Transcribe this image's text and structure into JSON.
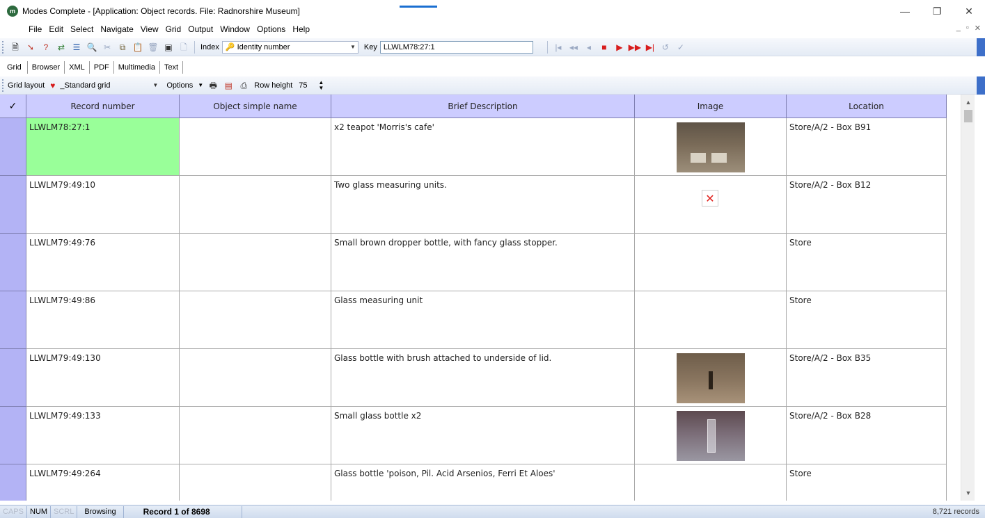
{
  "window": {
    "title": "Modes Complete - [Application: Object records. File: Radnorshire Museum]",
    "logo": "m",
    "controls": [
      "—",
      "❐",
      "✕"
    ]
  },
  "menu": [
    "File",
    "Edit",
    "Select",
    "Navigate",
    "View",
    "Grid",
    "Output",
    "Window",
    "Options",
    "Help"
  ],
  "mdi_controls": [
    "_",
    "▫",
    "✕"
  ],
  "toolbar": {
    "index_label": "Index",
    "index_value": "Identity number",
    "key_label": "Key",
    "key_value": "LLWLM78:27:1"
  },
  "tabs": [
    "Grid",
    "Browser",
    "XML",
    "PDF",
    "Multimedia",
    "Text"
  ],
  "gridbar": {
    "layout_label": "Grid layout",
    "layout_value": "_Standard grid",
    "options_label": "Options",
    "row_height_label": "Row height",
    "row_height_value": "75"
  },
  "grid": {
    "select_header": "✓",
    "columns": [
      "Record number",
      "Object simple name",
      "Brief Description",
      "Image",
      "Location"
    ],
    "rows": [
      {
        "record": "LLWLM78:27:1",
        "name": "",
        "description": "x2 teapot 'Morris's cafe'",
        "image": "thumbnail",
        "location": "Store/A/2 - Box B91"
      },
      {
        "record": "LLWLM79:49:10",
        "name": "",
        "description": "Two glass measuring units.",
        "image": "broken",
        "location": "Store/A/2 - Box B12"
      },
      {
        "record": "LLWLM79:49:76",
        "name": "",
        "description": "Small brown dropper bottle, with fancy glass stopper.",
        "image": "",
        "location": "Store"
      },
      {
        "record": "LLWLM79:49:86",
        "name": "",
        "description": "Glass measuring unit",
        "image": "",
        "location": "Store"
      },
      {
        "record": "LLWLM79:49:130",
        "name": "",
        "description": "Glass bottle with brush attached to underside of lid.",
        "image": "thumbnail",
        "location": "Store/A/2 - Box B35"
      },
      {
        "record": "LLWLM79:49:133",
        "name": "",
        "description": "Small glass bottle x2",
        "image": "thumbnail",
        "location": "Store/A/2 - Box B28"
      },
      {
        "record": "LLWLM79:49:264",
        "name": "",
        "description": "Glass bottle 'poison, Pil. Acid Arsenios, Ferri Et Aloes'",
        "image": "",
        "location": "Store"
      }
    ]
  },
  "statusbar": {
    "caps": "CAPS",
    "num": "NUM",
    "scrl": "SCRL",
    "mode": "Browsing",
    "record": "Record 1 of 8698",
    "total": "8,721 records"
  },
  "colors": {
    "header_bg": "#ccccff",
    "selected_cell": "#99ff99",
    "row_selector": "#b3b3f5"
  }
}
